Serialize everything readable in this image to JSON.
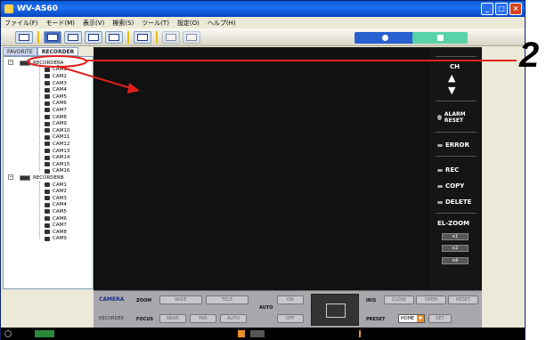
{
  "window": {
    "title": "WV-AS60",
    "controls": {
      "minimize": "_",
      "maximize": "□",
      "close": "×"
    }
  },
  "menu": [
    "ファイル(F)",
    "モード(M)",
    "表示(V)",
    "検索(S)",
    "ツール(T)",
    "設定(O)",
    "ヘルプ(H)"
  ],
  "tabs": [
    "FAVORITE",
    "RECORDER"
  ],
  "tree": {
    "recorders": [
      {
        "label": "RECORDERA",
        "cameras": [
          "CAM1",
          "CAM2",
          "CAM3",
          "CAM4",
          "CAM5",
          "CAM6",
          "CAM7",
          "CAM8",
          "CAM9",
          "CAM10",
          "CAM11",
          "CAM12",
          "CAM13",
          "CAM14",
          "CAM15",
          "CAM16"
        ]
      },
      {
        "label": "RECORDERB",
        "cameras": [
          "CAM1",
          "CAM2",
          "CAM3",
          "CAM4",
          "CAM5",
          "CAM6",
          "CAM7",
          "CAM8",
          "CAM9"
        ]
      }
    ]
  },
  "right_panel": {
    "ch": "CH",
    "alarm_reset": "ALARM RESET",
    "error": "ERROR",
    "rec": "REC",
    "copy": "COPY",
    "delete": "DELETE",
    "el_zoom": "EL-ZOOM",
    "zoom_levels": [
      "x1",
      "x2",
      "x4"
    ]
  },
  "controls": {
    "camera_tab": "CAMERA",
    "recorder_tab": "RECORDER",
    "zoom": "ZOOM",
    "wide": "WIDE",
    "tele": "TELE",
    "focus": "FOCUS",
    "near": "NEAR",
    "far": "FAR",
    "auto": "AUTO",
    "on": "ON",
    "off": "OFF",
    "auto_label": "AUTO",
    "iris": "IRIS",
    "close": "CLOSE",
    "open": "OPEN",
    "reset": "RESET",
    "preset": "PRESET",
    "home": "HOME",
    "set": "SET"
  },
  "annotation": {
    "number": "2"
  },
  "colors": {
    "accent": "#e0201c",
    "title_bar": "#0a5bd8",
    "panel_dark": "#151515"
  }
}
